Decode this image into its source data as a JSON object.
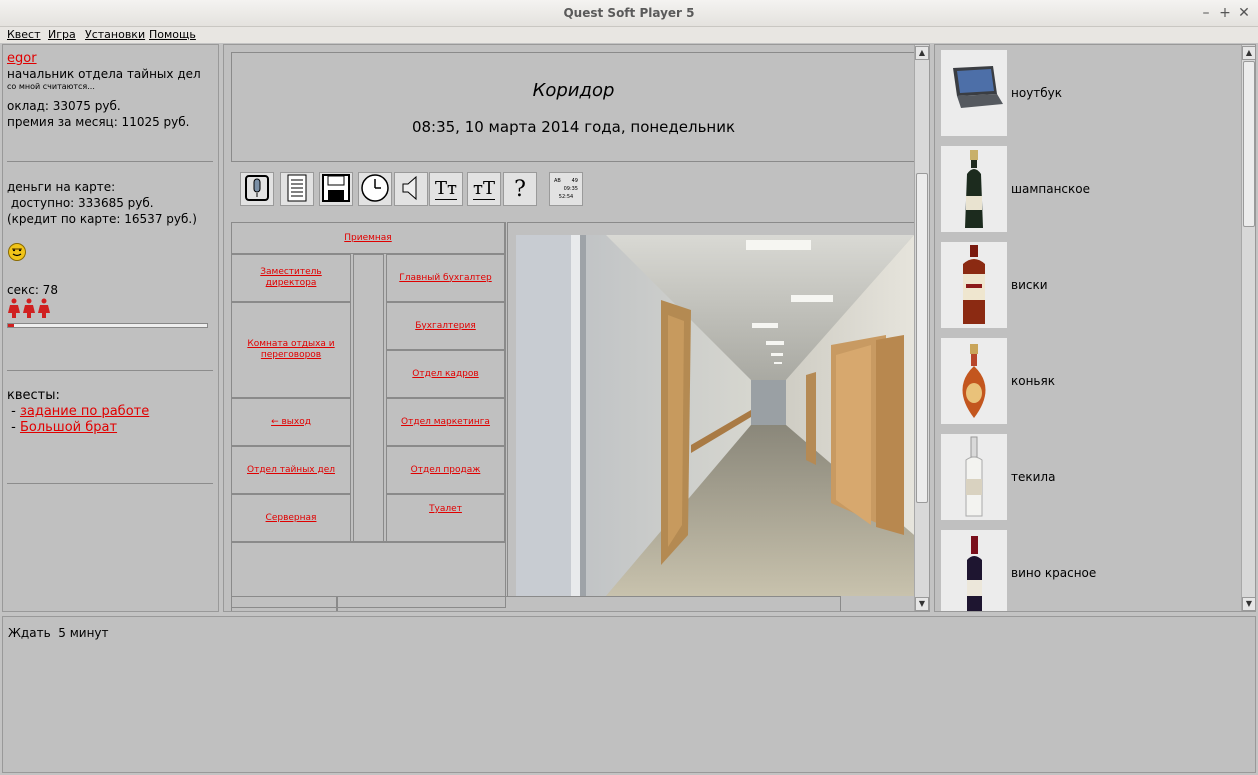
{
  "window": {
    "title": "Quest Soft Player 5"
  },
  "menu": [
    "Квест",
    "Игра",
    "Установки",
    "Помощь"
  ],
  "player": {
    "name": "egor",
    "position": "начальник отдела тайных дел",
    "motto": "со мной считаются...",
    "salary": "оклад: 33075 руб.",
    "bonus": "премия за месяц: 11025 руб.",
    "card_header": "деньги на карте:",
    "card_available": " доступно: 333685 руб.",
    "card_credit": "(кредит по карте: 16537 руб.)",
    "sex_label": "секс: 78",
    "sex_progress": 0.03,
    "quests_header": "квесты:",
    "quests": [
      "задание по работе",
      "Большой брат"
    ]
  },
  "location": {
    "name": "Коридор",
    "datetime": "08:35, 10 марта 2014 года, понедельник"
  },
  "toolbar": {
    "icons": [
      "microphone-icon",
      "notes-icon",
      "save-icon",
      "clock-icon",
      "speaker-icon",
      "font-increase-icon",
      "font-decrease-icon",
      "help-icon",
      "clock-digits-icon"
    ],
    "help_glyph": "?",
    "font_up_glyph": "Tт",
    "font_down_glyph": "тТ",
    "clock_digits": [
      "AB",
      "49",
      "09:35",
      "52:54"
    ]
  },
  "navigation": {
    "top": "Приемная",
    "left": [
      "Заместитель директора",
      "Комната отдыха и переговоров",
      "← выход",
      "Отдел тайных дел",
      "Серверная"
    ],
    "right": [
      "Главный бухгалтер",
      "Бухгалтерия",
      "Отдел кадров",
      "Отдел маркетинга",
      "Отдел продаж",
      "Туалет"
    ]
  },
  "inventory": [
    {
      "label": "ноутбук",
      "icon": "laptop-icon"
    },
    {
      "label": "шампанское",
      "icon": "champagne-bottle-icon"
    },
    {
      "label": "виски",
      "icon": "whisky-bottle-icon"
    },
    {
      "label": "коньяк",
      "icon": "cognac-bottle-icon"
    },
    {
      "label": "текила",
      "icon": "tequila-bottle-icon"
    },
    {
      "label": "вино красное",
      "icon": "red-wine-bottle-icon"
    }
  ],
  "status": {
    "message": "Ждать  5 минут"
  },
  "colors": {
    "link": "#e00000",
    "panel": "#c0c0c0",
    "accent": "#e00000"
  }
}
